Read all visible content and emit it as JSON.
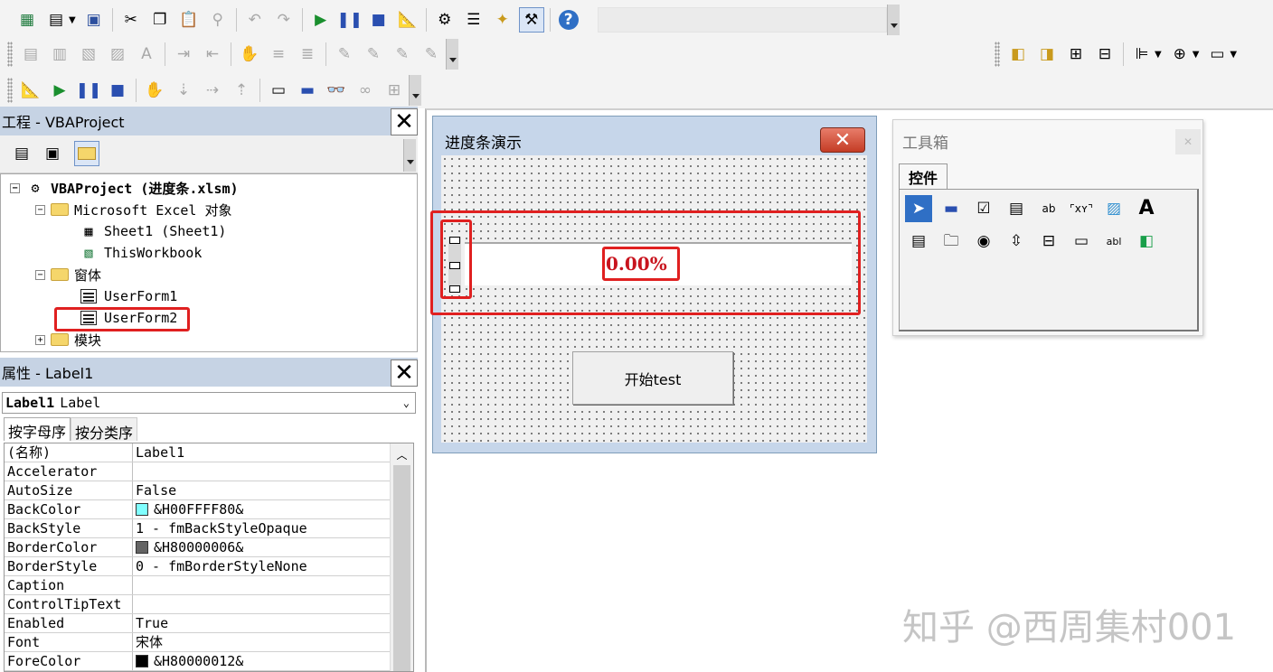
{
  "toolbars": {
    "row1_icons": [
      "excel-icon",
      "view-object-icon",
      "save-icon",
      "cut-icon",
      "copy-icon",
      "paste-icon",
      "find-icon",
      "undo-icon",
      "redo-icon",
      "run-icon",
      "pause-icon",
      "stop-icon",
      "design-mode-icon",
      "project-explorer-icon",
      "properties-icon",
      "object-browser-icon",
      "toolbox-icon",
      "help-icon"
    ],
    "row2_icons": [
      "format-icon"
    ],
    "row3_icons": [
      "design-mode-icon",
      "run-icon",
      "pause-icon",
      "stop-icon"
    ]
  },
  "project": {
    "title": "工程 - VBAProject",
    "tree": {
      "root": "VBAProject (进度条.xlsm)",
      "excel_objects": "Microsoft Excel 对象",
      "sheet1": "Sheet1 (Sheet1)",
      "thisworkbook": "ThisWorkbook",
      "forms": "窗体",
      "userform1": "UserForm1",
      "userform2": "UserForm2",
      "modules": "模块"
    }
  },
  "properties": {
    "title": "属性 - Label1",
    "object_name": "Label1",
    "object_type": "Label",
    "tab_alpha": "按字母序",
    "tab_category": "按分类序",
    "rows": [
      {
        "name": "(名称)",
        "value": "Label1"
      },
      {
        "name": "Accelerator",
        "value": ""
      },
      {
        "name": "AutoSize",
        "value": "False"
      },
      {
        "name": "BackColor",
        "value": "&H00FFFF80&",
        "swatch": "#80ffff"
      },
      {
        "name": "BackStyle",
        "value": "1 - fmBackStyleOpaque"
      },
      {
        "name": "BorderColor",
        "value": "&H80000006&",
        "swatch": "#646464"
      },
      {
        "name": "BorderStyle",
        "value": "0 - fmBorderStyleNone"
      },
      {
        "name": "Caption",
        "value": ""
      },
      {
        "name": "ControlTipText",
        "value": ""
      },
      {
        "name": "Enabled",
        "value": "True"
      },
      {
        "name": "Font",
        "value": "宋体"
      },
      {
        "name": "ForeColor",
        "value": "&H80000012&",
        "swatch": "#000000"
      }
    ]
  },
  "userform": {
    "caption": "进度条演示",
    "percent": "0.00%",
    "button": "开始test"
  },
  "toolbox": {
    "title": "工具箱",
    "tab": "控件",
    "tools": [
      "pointer-icon",
      "label-icon",
      "checkbox-icon",
      "combobox-icon",
      "textbox-icon",
      "frame-icon",
      "image-icon",
      "text-label-icon",
      "listbox-icon",
      "multipage-icon",
      "optionbutton-icon",
      "spinbutton-icon",
      "tabstrip-icon",
      "scrollbar-icon",
      "refedit-icon",
      "togglebutton-icon"
    ]
  },
  "watermark": "知乎 @西周集村001",
  "colors": {
    "accent_red": "#e02020",
    "panel_title": "#c6d3e4"
  }
}
